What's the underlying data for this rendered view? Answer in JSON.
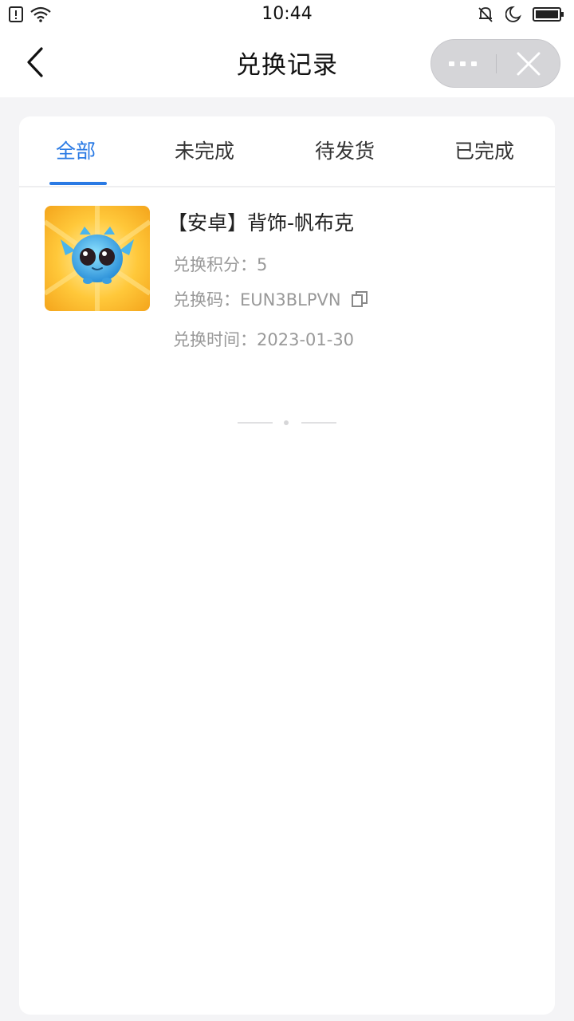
{
  "status_bar": {
    "time": "10:44",
    "icons_left": [
      "sim-alert-icon",
      "wifi-icon"
    ],
    "icons_right": [
      "mute-bell-icon",
      "moon-icon",
      "battery-icon"
    ]
  },
  "nav": {
    "title": "兑换记录",
    "back_icon": "chevron-left-icon",
    "more_icon": "more-dots-icon",
    "close_icon": "close-icon"
  },
  "tabs": [
    {
      "label": "全部",
      "active": true
    },
    {
      "label": "未完成",
      "active": false
    },
    {
      "label": "待发货",
      "active": false
    },
    {
      "label": "已完成",
      "active": false
    }
  ],
  "records": [
    {
      "name": "【安卓】背饰-帆布克",
      "points_label": "兑换积分：",
      "points": "5",
      "code_label": "兑换码：",
      "code": "EUN3BLPVN",
      "time_label": "兑换时间：",
      "time": "2023-01-30"
    }
  ],
  "colors": {
    "accent": "#2a7ae4",
    "background": "#f4f4f6",
    "secondary_text": "#999999"
  }
}
